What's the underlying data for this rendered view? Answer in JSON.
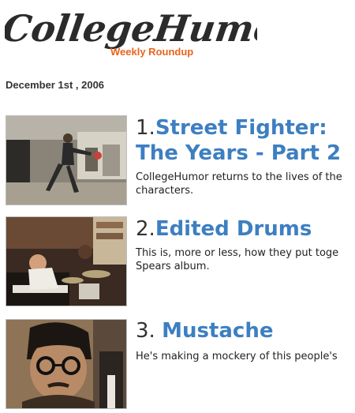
{
  "header": {
    "logo_text": "CollegeHumor",
    "subtitle": "Weekly Roundup"
  },
  "date": "December 1st , 2006",
  "items": [
    {
      "number": "1.",
      "title": "Street Fighter: The Years - Part 2",
      "description_line1": "CollegeHumor returns to the lives of the",
      "description_line2": "characters."
    },
    {
      "number": "2.",
      "title": "Edited Drums",
      "description_line1": "This is, more or less, how they put toge",
      "description_line2": "Spears album."
    },
    {
      "number": "3. ",
      "title": "Mustache",
      "description_line1": "He's making a mockery of this people's",
      "description_line2": ""
    }
  ],
  "colors": {
    "link": "#3d7fc1",
    "subtitle": "#e8641e",
    "logo": "#2b2b2b"
  }
}
